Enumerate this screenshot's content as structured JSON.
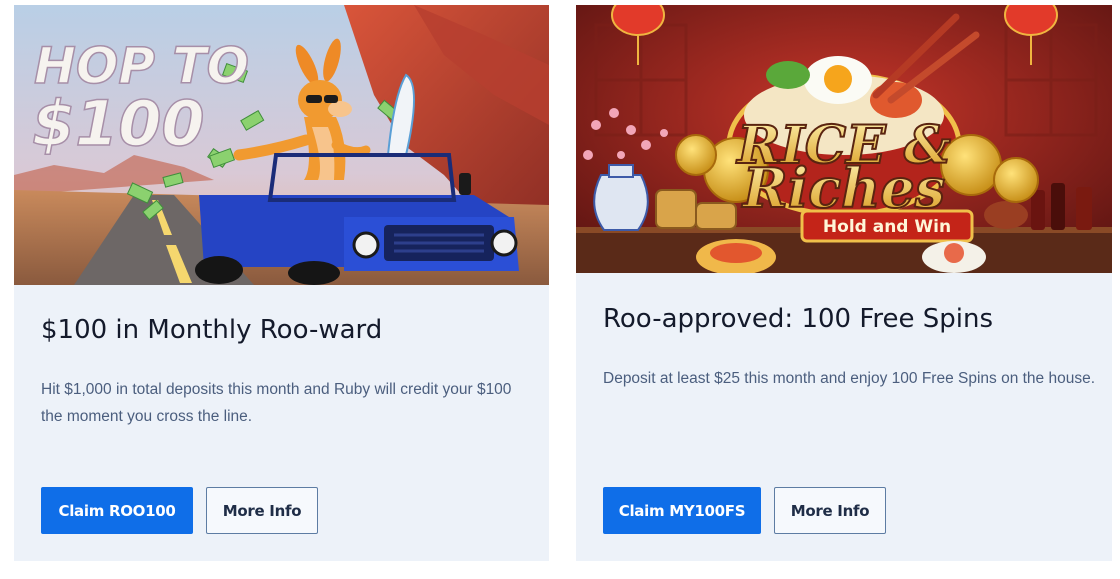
{
  "cards": [
    {
      "art_text_line1": "HOP TO",
      "art_text_line2": "$100",
      "title": "$100 in Monthly Roo-ward",
      "description": "Hit $1,000 in total deposits this month and Ruby will credit your $100 the moment you cross the line.",
      "claim_label": "Claim ROO100",
      "more_label": "More Info"
    },
    {
      "art_text_line1": "RICE &",
      "art_text_line2": "Riches",
      "art_badge": "Hold and Win",
      "title": "Roo-approved: 100 Free Spins",
      "description": "Deposit at least $25 this month and enjoy 100 Free Spins on the house.",
      "claim_label": "Claim MY100FS",
      "more_label": "More Info"
    }
  ],
  "colors": {
    "card_background": "#edf2f9",
    "primary_button": "#0f6ee8",
    "outline_border": "#5d7ca3",
    "title_text": "#141a2b",
    "body_text": "#4b5e7e"
  }
}
